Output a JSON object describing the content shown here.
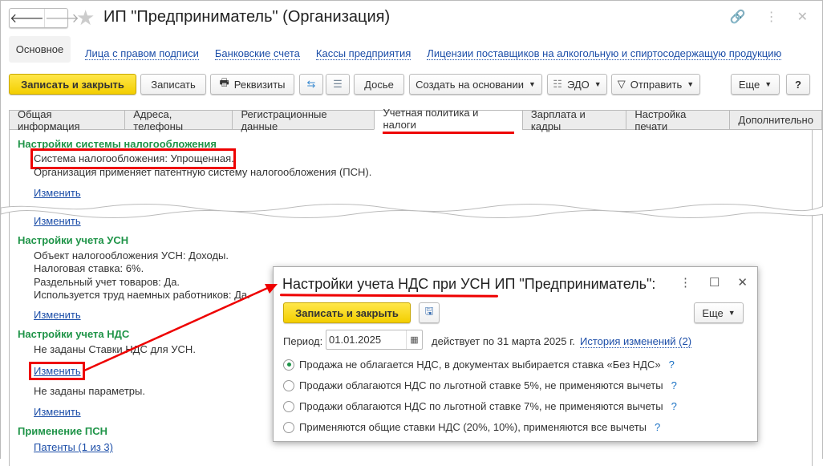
{
  "window": {
    "title": "ИП \"Предприниматель\" (Организация)"
  },
  "nav": {
    "primary": "Основное",
    "links": [
      "Лица с правом подписи",
      "Банковские счета",
      "Кассы предприятия",
      "Лицензии поставщиков на алкогольную и спиртосодержащую продукцию"
    ]
  },
  "toolbar": {
    "save_close": "Записать и закрыть",
    "save": "Записать",
    "requisites": "Реквизиты",
    "dossier": "Досье",
    "create_based": "Создать на основании",
    "edo": "ЭДО",
    "send": "Отправить",
    "more": "Еще",
    "help": "?"
  },
  "tabs": [
    "Общая информация",
    "Адреса, телефоны",
    "Регистрационные данные",
    "Учетная политика и налоги",
    "Зарплата и кадры",
    "Настройка печати",
    "Дополнительно"
  ],
  "active_tab": "Учетная политика и налоги",
  "sections": {
    "tax_system": {
      "heading": "Настройки системы налогообложения",
      "line1": "Система налогообложения: Упрощенная.",
      "line2": "Организация применяет патентную систему налогообложения (ПСН).",
      "link": "Изменить"
    },
    "hidden": {
      "link": "Изменить"
    },
    "usn": {
      "heading": "Настройки учета УСН",
      "lines": [
        "Объект налогообложения УСН: Доходы.",
        "Налоговая ставка: 6%.",
        "Раздельный учет товаров: Да.",
        "Используется труд наемных работников: Да."
      ],
      "link": "Изменить"
    },
    "nds": {
      "heading": "Настройки учета НДС",
      "line1": "Не заданы Ставки НДС для УСН.",
      "link1": "Изменить",
      "line2": "Не заданы параметры.",
      "link2": "Изменить"
    },
    "psn": {
      "heading": "Применение ПСН",
      "link": "Патенты (1 из 3)"
    }
  },
  "dialog": {
    "title": "Настройки учета НДС при УСН ИП \"Предприниматель\":",
    "save_close": "Записать и закрыть",
    "more": "Еще",
    "period_label": "Период:",
    "period_value": "01.01.2025",
    "valid_text": "действует по 31 марта 2025 г.",
    "history_link": "История изменений (2)",
    "options": [
      {
        "label": "Продажа не облагается НДС, в документах выбирается ставка «Без НДС»",
        "selected": true
      },
      {
        "label": "Продажи облагаются НДС по льготной ставке 5%, не применяются вычеты",
        "selected": false
      },
      {
        "label": "Продажи облагаются НДС по льготной ставке 7%, не применяются вычеты",
        "selected": false
      },
      {
        "label": "Применяются общие ставки НДС (20%, 10%), применяются все вычеты",
        "selected": false
      }
    ],
    "help": "?"
  },
  "colors": {
    "accent_yellow": "#f3ce00",
    "heading_green": "#1f9448",
    "link_blue": "#1c4ea8",
    "annotation_red": "#e00000"
  }
}
